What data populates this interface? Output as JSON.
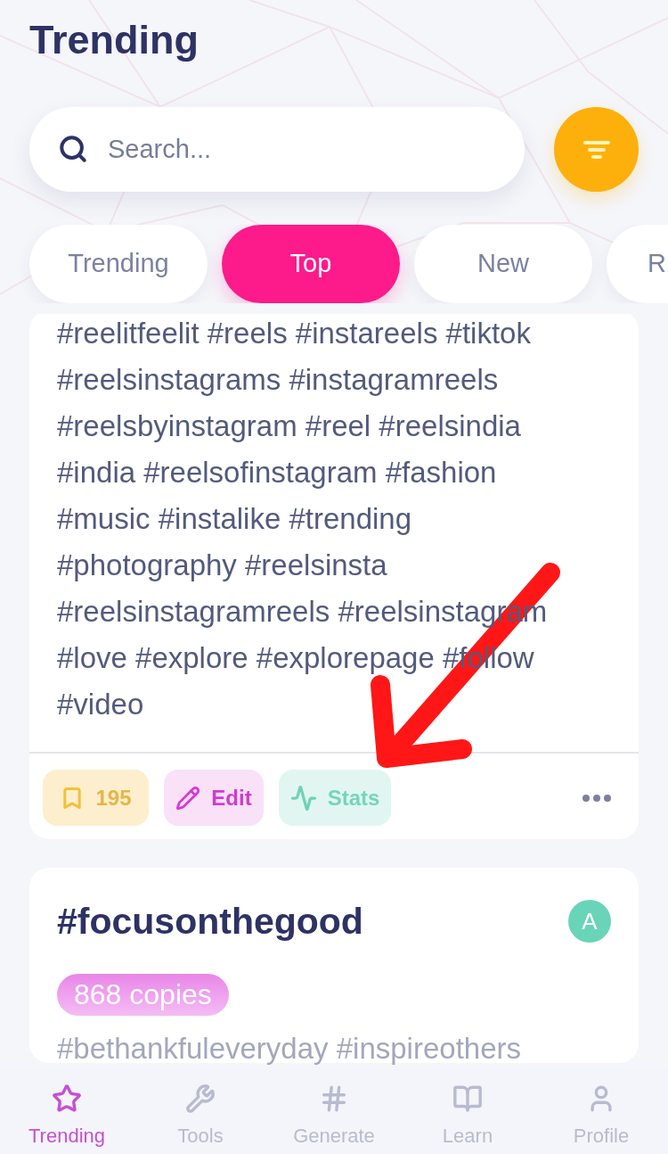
{
  "header": {
    "title": "Trending"
  },
  "search": {
    "placeholder": "Search..."
  },
  "tabs": [
    {
      "label": "Trending",
      "selected": false
    },
    {
      "label": "Top",
      "selected": true
    },
    {
      "label": "New",
      "selected": false
    },
    {
      "label": "R",
      "selected": false
    }
  ],
  "cards": [
    {
      "hashtag_lines": [
        "#reelitfeelit #reels #instareels #tiktok",
        "#reelsinstagrams #instagramreels",
        "#reelsbyinstagram #reel #reelsindia",
        "#india #reelsofinstagram #fashion",
        "#music #instalike #trending",
        "#photography #reelsinsta",
        "#reelsinstagramreels #reelsinstagram",
        "#love #explore #explorepage #follow",
        "#video"
      ],
      "actions": [
        {
          "kind": "save",
          "label": "195"
        },
        {
          "kind": "edit",
          "label": "Edit"
        },
        {
          "kind": "stats",
          "label": "Stats"
        }
      ]
    },
    {
      "title": "#focusonthegood",
      "avatar": "A",
      "copies": "868 copies",
      "hashtag_lines": [
        "#bethankfuleveryday #inspireothers"
      ]
    }
  ],
  "bottom_nav": [
    {
      "label": "Trending",
      "selected": true
    },
    {
      "label": "Tools",
      "selected": false
    },
    {
      "label": "Generate",
      "selected": false
    },
    {
      "label": "Learn",
      "selected": false
    },
    {
      "label": "Profile",
      "selected": false
    }
  ]
}
